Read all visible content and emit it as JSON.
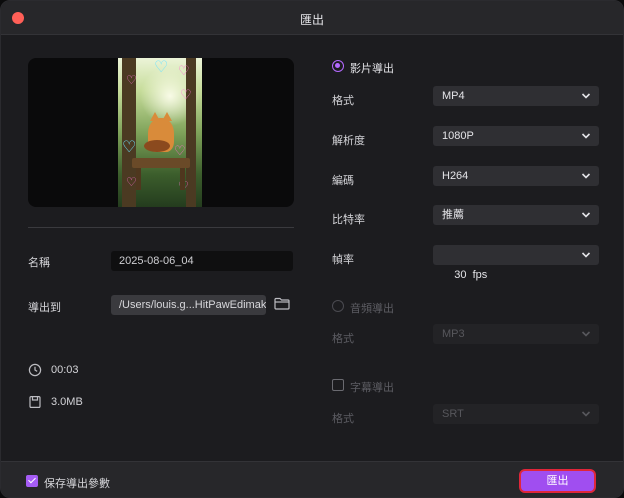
{
  "window": {
    "title": "匯出"
  },
  "left": {
    "name_label": "名稱",
    "name_value": "2025-08-06_04",
    "export_to_label": "導出到",
    "export_path": "/Users/louis.g...HitPawEdimakor",
    "duration": "00:03",
    "file_size": "3.0MB"
  },
  "video_section": {
    "label": "影片導出",
    "rows": [
      {
        "label": "格式",
        "value": "MP4"
      },
      {
        "label": "解析度",
        "value": "1080P"
      },
      {
        "label": "編碼",
        "value": "H264"
      },
      {
        "label": "比特率",
        "value": "推薦"
      },
      {
        "label": "幀率",
        "value": "30  fps"
      }
    ]
  },
  "audio_section": {
    "label": "音頻導出",
    "format_label": "格式",
    "format_value": "MP3"
  },
  "subtitle_section": {
    "label": "字幕導出",
    "format_label": "格式",
    "format_value": "SRT"
  },
  "footer": {
    "save_params_label": "保存導出參數",
    "export_button": "匯出"
  },
  "colors": {
    "accent": "#a04ef0",
    "highlight_border": "#e0263a",
    "close_dot": "#ff5f57"
  }
}
